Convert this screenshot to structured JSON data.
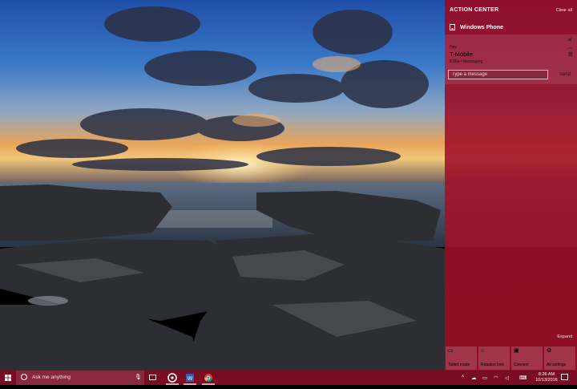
{
  "action_center": {
    "title": "ACTION CENTER",
    "clear_all": "Clear all",
    "group_label": "Windows Phone",
    "notification": {
      "preview": "Hey",
      "sender": "T-Mobile",
      "meta": "8:26a • Messaging",
      "reply_placeholder": "Type a message",
      "send_label": "Send"
    },
    "expand_label": "Expand",
    "quick_actions": [
      {
        "icon": "tablet-mode-icon",
        "label": "Tablet mode"
      },
      {
        "icon": "rotation-lock-icon",
        "label": "Rotation lock"
      },
      {
        "icon": "connect-icon",
        "label": "Connect"
      },
      {
        "icon": "settings-gear-icon",
        "label": "All settings"
      }
    ],
    "accent_color": "#9b0f2a"
  },
  "taskbar": {
    "search_placeholder": "Ask me anything",
    "clock_time": "8:26 AM",
    "clock_date": "10/13/2016",
    "taskbar_color": "#7a0c22"
  }
}
